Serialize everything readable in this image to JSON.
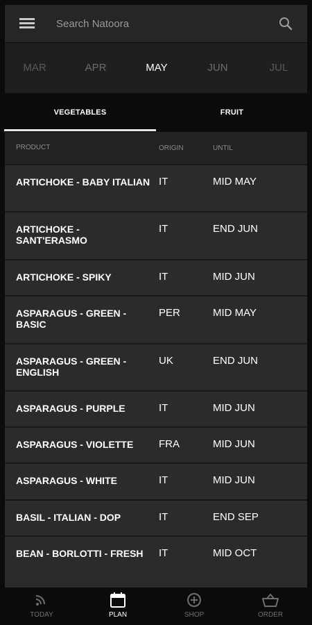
{
  "search": {
    "placeholder": "Search Natoora"
  },
  "months": [
    "MAR",
    "APR",
    "MAY",
    "JUN",
    "JUL"
  ],
  "active_month": "MAY",
  "tabs": [
    {
      "label": "VEGETABLES",
      "active": true
    },
    {
      "label": "FRUIT",
      "active": false
    }
  ],
  "table": {
    "headers": {
      "product": "PRODUCT",
      "origin": "ORIGIN",
      "until": "UNTIL"
    },
    "rows": [
      {
        "product": "ARTICHOKE - BABY ITALIAN",
        "origin": "IT",
        "until": "MID MAY"
      },
      {
        "product": "ARTICHOKE - SANT'ERASMO",
        "origin": "IT",
        "until": "END JUN"
      },
      {
        "product": "ARTICHOKE - SPIKY",
        "origin": "IT",
        "until": "MID JUN"
      },
      {
        "product": "ASPARAGUS - GREEN - BASIC",
        "origin": "PER",
        "until": "MID MAY"
      },
      {
        "product": "ASPARAGUS - GREEN - ENGLISH",
        "origin": "UK",
        "until": "END JUN"
      },
      {
        "product": "ASPARAGUS - PURPLE",
        "origin": "IT",
        "until": "MID JUN"
      },
      {
        "product": "ASPARAGUS - VIOLETTE",
        "origin": "FRA",
        "until": "MID JUN"
      },
      {
        "product": "ASPARAGUS - WHITE",
        "origin": "IT",
        "until": "MID JUN"
      },
      {
        "product": "BASIL - ITALIAN - DOP",
        "origin": "IT",
        "until": "END SEP"
      },
      {
        "product": "BEAN - BORLOTTI  - FRESH",
        "origin": "IT",
        "until": "MID OCT"
      }
    ]
  },
  "bottom_nav": [
    {
      "label": "TODAY",
      "icon": "rss-feed-icon",
      "active": false
    },
    {
      "label": "PLAN",
      "icon": "calendar-icon",
      "active": true
    },
    {
      "label": "SHOP",
      "icon": "plus-circle-icon",
      "active": false
    },
    {
      "label": "ORDER",
      "icon": "basket-icon",
      "active": false
    }
  ],
  "colors": {
    "background": "#0b0b0b",
    "surface": "#262626",
    "row": "#2b2b2b",
    "muted": "#8c8c8c"
  }
}
